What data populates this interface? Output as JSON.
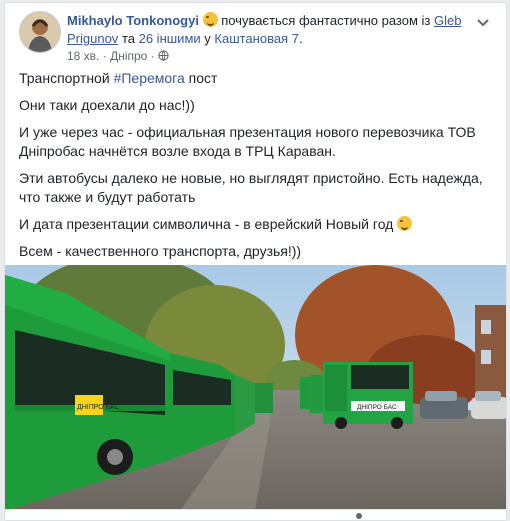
{
  "post": {
    "author": "Mikhaylo Tonkonogyi",
    "feeling_text": "почувається фантастично разом із",
    "tagged_user": "Gleb Prigunov",
    "and_text": "та",
    "others_link": "26 іншими",
    "in_text": "у",
    "place": "Каштановая 7",
    "place_suffix": ".",
    "time": "18 хв.",
    "location": "Дніпро",
    "separator": "·",
    "lines": [
      "Транспортной",
      "Они таки доехали до нас!))",
      "И уже через час - официальная презентация нового перевозчика ТОВ Дніпробас начнётся возле входа в ТРЦ Караван.",
      "Эти автобусы далеко не новые, но выглядят пристойно. Есть надежда, что также и будут работать",
      "И дата презентации символична - в еврейский Новый год",
      "Всем - качественного транспорта, друзья!))"
    ],
    "hashtag": "#Перемога",
    "hashtag_suffix": "пост"
  },
  "photo": {
    "bus_side_text": "ДНІПРО БАС",
    "bus_front_text": "ДНІПРО БАС"
  },
  "icons": {
    "avatar": "avatar-image",
    "feeling": "grinning-emoji-icon",
    "globe": "globe-icon",
    "menu": "chevron-down-icon"
  }
}
